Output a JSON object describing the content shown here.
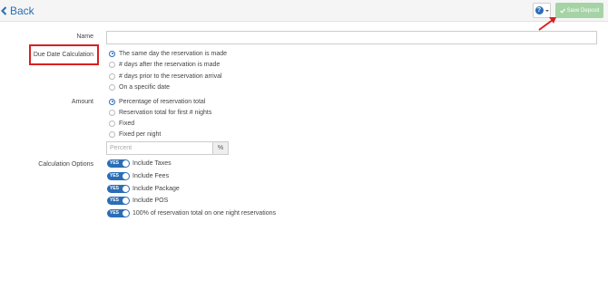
{
  "toolbar": {
    "back_label": "Back",
    "save_label": "Save Deposit",
    "help_icon": "question-circle-icon"
  },
  "form": {
    "name_label": "Name",
    "name_value": "",
    "due_date_label": "Due Date Calculation",
    "due_date_options": [
      "The same day the reservation is made",
      "# days after the reservation is made",
      "# days prior to the reservation arrival",
      "On a specific date"
    ],
    "due_date_selected": 0,
    "amount_label": "Amount",
    "amount_options": [
      "Percentage of reservation total",
      "Reservation total for first # nights",
      "Fixed",
      "Fixed per night"
    ],
    "amount_selected": 0,
    "percent_placeholder": "Percent",
    "percent_addon": "%",
    "calc_label": "Calculation Options",
    "toggle_on_text": "YES",
    "calc_options": [
      "Include Taxes",
      "Include Fees",
      "Include Package",
      "Include POS",
      "100% of reservation total on one night reservations"
    ]
  },
  "colors": {
    "accent": "#2a6eb5",
    "save_disabled": "#a6d3a6",
    "annotation_red": "#d9201f"
  }
}
